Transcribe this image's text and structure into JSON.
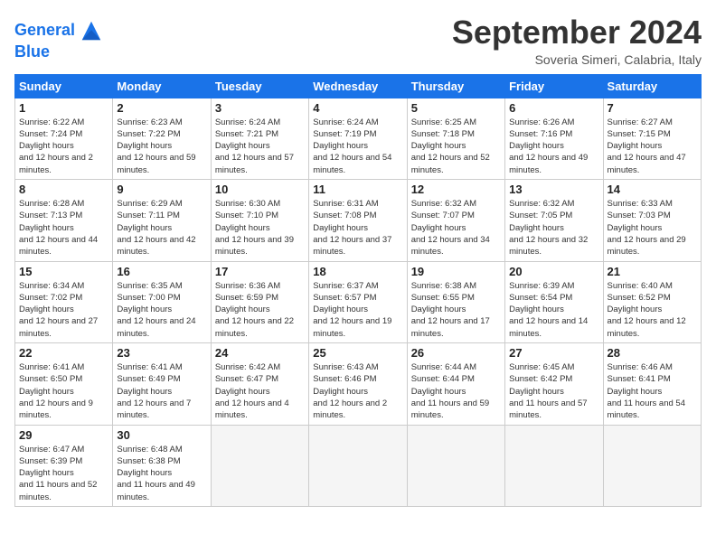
{
  "header": {
    "logo_line1": "General",
    "logo_line2": "Blue",
    "month_title": "September 2024",
    "subtitle": "Soveria Simeri, Calabria, Italy"
  },
  "days_of_week": [
    "Sunday",
    "Monday",
    "Tuesday",
    "Wednesday",
    "Thursday",
    "Friday",
    "Saturday"
  ],
  "weeks": [
    [
      {
        "day": "1",
        "sunrise": "6:22 AM",
        "sunset": "7:24 PM",
        "daylight": "12 hours and 2 minutes."
      },
      {
        "day": "2",
        "sunrise": "6:23 AM",
        "sunset": "7:22 PM",
        "daylight": "12 hours and 59 minutes."
      },
      {
        "day": "3",
        "sunrise": "6:24 AM",
        "sunset": "7:21 PM",
        "daylight": "12 hours and 57 minutes."
      },
      {
        "day": "4",
        "sunrise": "6:24 AM",
        "sunset": "7:19 PM",
        "daylight": "12 hours and 54 minutes."
      },
      {
        "day": "5",
        "sunrise": "6:25 AM",
        "sunset": "7:18 PM",
        "daylight": "12 hours and 52 minutes."
      },
      {
        "day": "6",
        "sunrise": "6:26 AM",
        "sunset": "7:16 PM",
        "daylight": "12 hours and 49 minutes."
      },
      {
        "day": "7",
        "sunrise": "6:27 AM",
        "sunset": "7:15 PM",
        "daylight": "12 hours and 47 minutes."
      }
    ],
    [
      {
        "day": "8",
        "sunrise": "6:28 AM",
        "sunset": "7:13 PM",
        "daylight": "12 hours and 44 minutes."
      },
      {
        "day": "9",
        "sunrise": "6:29 AM",
        "sunset": "7:11 PM",
        "daylight": "12 hours and 42 minutes."
      },
      {
        "day": "10",
        "sunrise": "6:30 AM",
        "sunset": "7:10 PM",
        "daylight": "12 hours and 39 minutes."
      },
      {
        "day": "11",
        "sunrise": "6:31 AM",
        "sunset": "7:08 PM",
        "daylight": "12 hours and 37 minutes."
      },
      {
        "day": "12",
        "sunrise": "6:32 AM",
        "sunset": "7:07 PM",
        "daylight": "12 hours and 34 minutes."
      },
      {
        "day": "13",
        "sunrise": "6:32 AM",
        "sunset": "7:05 PM",
        "daylight": "12 hours and 32 minutes."
      },
      {
        "day": "14",
        "sunrise": "6:33 AM",
        "sunset": "7:03 PM",
        "daylight": "12 hours and 29 minutes."
      }
    ],
    [
      {
        "day": "15",
        "sunrise": "6:34 AM",
        "sunset": "7:02 PM",
        "daylight": "12 hours and 27 minutes."
      },
      {
        "day": "16",
        "sunrise": "6:35 AM",
        "sunset": "7:00 PM",
        "daylight": "12 hours and 24 minutes."
      },
      {
        "day": "17",
        "sunrise": "6:36 AM",
        "sunset": "6:59 PM",
        "daylight": "12 hours and 22 minutes."
      },
      {
        "day": "18",
        "sunrise": "6:37 AM",
        "sunset": "6:57 PM",
        "daylight": "12 hours and 19 minutes."
      },
      {
        "day": "19",
        "sunrise": "6:38 AM",
        "sunset": "6:55 PM",
        "daylight": "12 hours and 17 minutes."
      },
      {
        "day": "20",
        "sunrise": "6:39 AM",
        "sunset": "6:54 PM",
        "daylight": "12 hours and 14 minutes."
      },
      {
        "day": "21",
        "sunrise": "6:40 AM",
        "sunset": "6:52 PM",
        "daylight": "12 hours and 12 minutes."
      }
    ],
    [
      {
        "day": "22",
        "sunrise": "6:41 AM",
        "sunset": "6:50 PM",
        "daylight": "12 hours and 9 minutes."
      },
      {
        "day": "23",
        "sunrise": "6:41 AM",
        "sunset": "6:49 PM",
        "daylight": "12 hours and 7 minutes."
      },
      {
        "day": "24",
        "sunrise": "6:42 AM",
        "sunset": "6:47 PM",
        "daylight": "12 hours and 4 minutes."
      },
      {
        "day": "25",
        "sunrise": "6:43 AM",
        "sunset": "6:46 PM",
        "daylight": "12 hours and 2 minutes."
      },
      {
        "day": "26",
        "sunrise": "6:44 AM",
        "sunset": "6:44 PM",
        "daylight": "11 hours and 59 minutes."
      },
      {
        "day": "27",
        "sunrise": "6:45 AM",
        "sunset": "6:42 PM",
        "daylight": "11 hours and 57 minutes."
      },
      {
        "day": "28",
        "sunrise": "6:46 AM",
        "sunset": "6:41 PM",
        "daylight": "11 hours and 54 minutes."
      }
    ],
    [
      {
        "day": "29",
        "sunrise": "6:47 AM",
        "sunset": "6:39 PM",
        "daylight": "11 hours and 52 minutes."
      },
      {
        "day": "30",
        "sunrise": "6:48 AM",
        "sunset": "6:38 PM",
        "daylight": "11 hours and 49 minutes."
      },
      null,
      null,
      null,
      null,
      null
    ]
  ]
}
